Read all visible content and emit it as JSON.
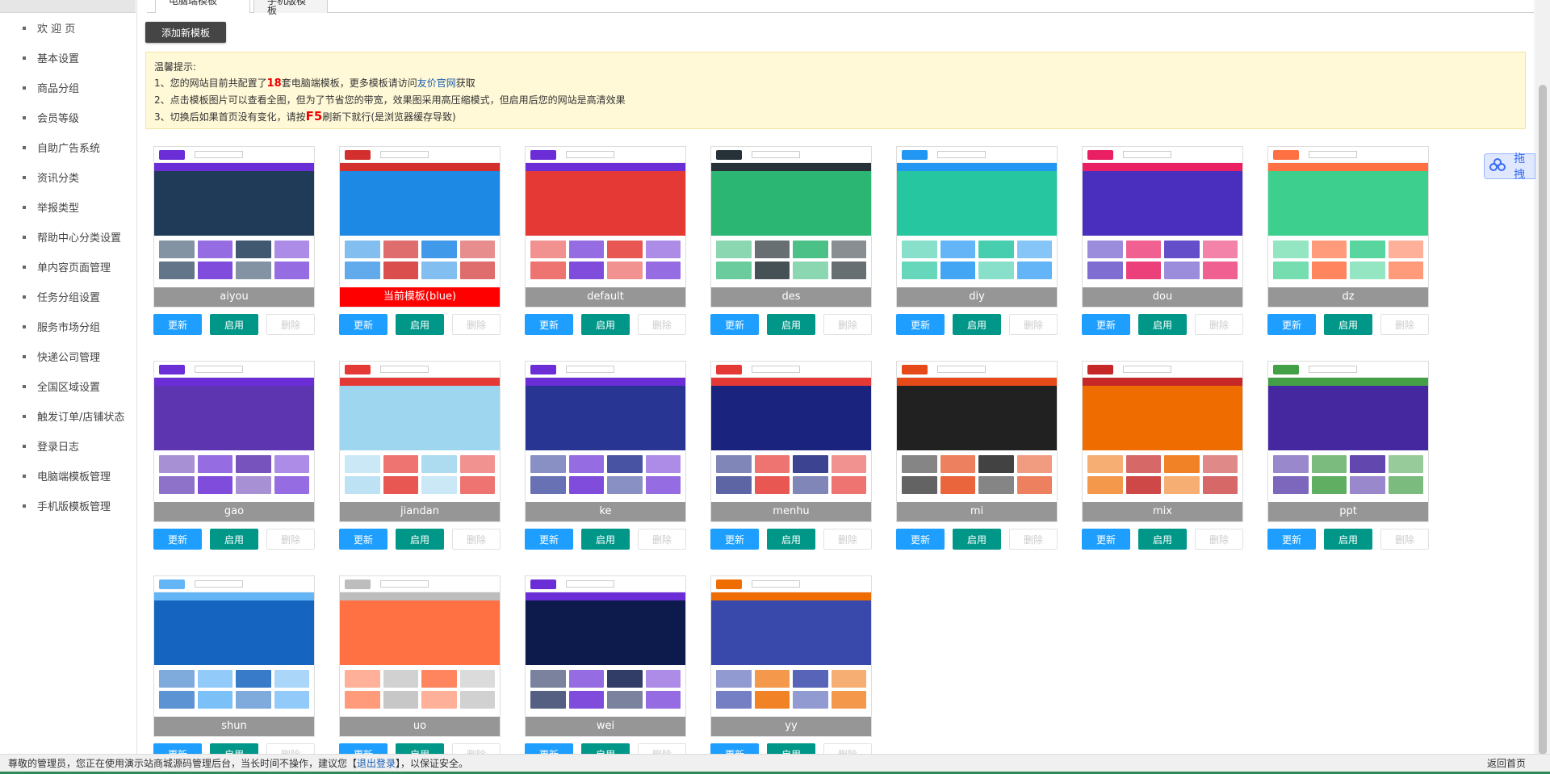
{
  "sidebar": {
    "items": [
      {
        "label": "欢 迎 页"
      },
      {
        "label": "基本设置"
      },
      {
        "label": "商品分组"
      },
      {
        "label": "会员等级"
      },
      {
        "label": "自助广告系统"
      },
      {
        "label": "资讯分类"
      },
      {
        "label": "举报类型"
      },
      {
        "label": "帮助中心分类设置"
      },
      {
        "label": "单内容页面管理"
      },
      {
        "label": "任务分组设置"
      },
      {
        "label": "服务市场分组"
      },
      {
        "label": "快递公司管理"
      },
      {
        "label": "全国区域设置"
      },
      {
        "label": "触发订单/店铺状态"
      },
      {
        "label": "登录日志"
      },
      {
        "label": "电脑端模板管理"
      },
      {
        "label": "手机版模板管理"
      }
    ]
  },
  "tabs": [
    {
      "label": "电脑端模板"
    },
    {
      "label": "手机版模板"
    }
  ],
  "toolbar": {
    "add_label": "添加新模板"
  },
  "tips": {
    "title": "温馨提示:",
    "line1_pre": "1、您的网站目前共配置了",
    "count": "18",
    "line1_mid": "套电脑端模板，更多模板请访问",
    "line1_link": "友价官网",
    "line1_post": "获取",
    "line2": "2、点击模板图片可以查看全图，但为了节省您的带宽，效果图采用高压缩模式，但启用后您的网站是高清效果",
    "line3_pre": "3、切换后如果首页没有变化，请按",
    "line3_key": "F5",
    "line3_post": "刷新下就行(是浏览器缓存导致)"
  },
  "buttons": {
    "update": "更新",
    "enable": "启用",
    "delete": "删除"
  },
  "templates": [
    {
      "name": "aiyou",
      "banner": "#1f3b57",
      "accent": "#6a2dd6"
    },
    {
      "name": "当前模板(blue)",
      "banner": "#1e88e5",
      "accent": "#d32f2f",
      "current": true
    },
    {
      "name": "default",
      "banner": "#e53935",
      "accent": "#6a2dd6"
    },
    {
      "name": "des",
      "banner": "#2bb673",
      "accent": "#263238"
    },
    {
      "name": "diy",
      "banner": "#26c6a0",
      "accent": "#2196f3"
    },
    {
      "name": "dou",
      "banner": "#4a2fbf",
      "accent": "#e91e63"
    },
    {
      "name": "dz",
      "banner": "#3ccf8e",
      "accent": "#ff7043"
    },
    {
      "name": "gao",
      "banner": "#5e35b1",
      "accent": "#6a2dd6"
    },
    {
      "name": "jiandan",
      "banner": "#9fd6ef",
      "accent": "#e53935"
    },
    {
      "name": "ke",
      "banner": "#283593",
      "accent": "#6a2dd6"
    },
    {
      "name": "menhu",
      "banner": "#1a237e",
      "accent": "#e53935"
    },
    {
      "name": "mi",
      "banner": "#212121",
      "accent": "#e64a19"
    },
    {
      "name": "mix",
      "banner": "#ef6c00",
      "accent": "#c62828"
    },
    {
      "name": "ppt",
      "banner": "#4527a0",
      "accent": "#43a047"
    },
    {
      "name": "shun",
      "banner": "#1565c0",
      "accent": "#64b5f6"
    },
    {
      "name": "uo",
      "banner": "#ff7043",
      "accent": "#bdbdbd"
    },
    {
      "name": "wei",
      "banner": "#0d1b4c",
      "accent": "#6a2dd6"
    },
    {
      "name": "yy",
      "banner": "#3949ab",
      "accent": "#ef6c00"
    }
  ],
  "footer": {
    "pre": "尊敬的管理员，您正在使用演示站商城源码管理后台，当长时间不操作，建议您【",
    "logout": "退出登录",
    "post": "】，以保证安全。",
    "home": "返回首页"
  },
  "float_widget": {
    "label": "拖拽",
    "icon": "baidu-cloud-icon"
  }
}
